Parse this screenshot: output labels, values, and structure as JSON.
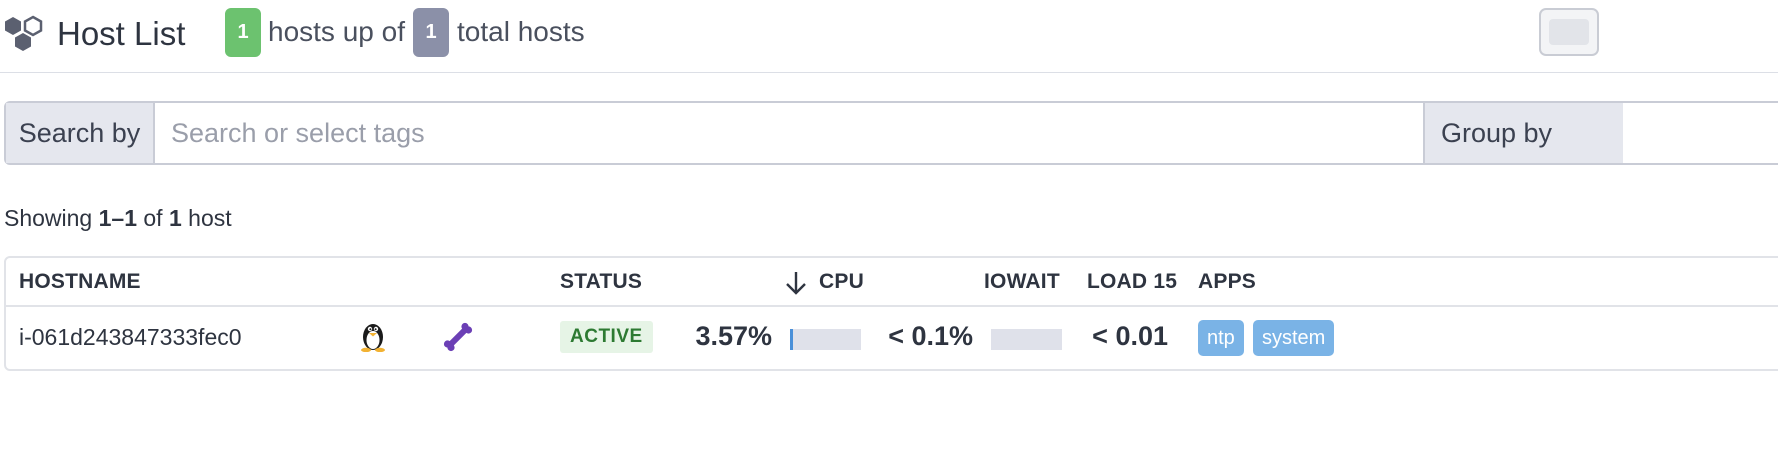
{
  "header": {
    "title": "Host List",
    "hosts_up_count": "1",
    "hosts_up_text": "hosts up of",
    "total_count": "1",
    "total_text": "total hosts"
  },
  "search": {
    "search_by_label": "Search by",
    "placeholder": "Search or select tags",
    "value": "",
    "group_by_label": "Group by"
  },
  "showing": {
    "prefix": "Showing",
    "range": "1–1",
    "of": "of",
    "count": "1",
    "suffix": "host"
  },
  "table": {
    "columns": {
      "hostname": "HOSTNAME",
      "status": "STATUS",
      "cpu": "CPU",
      "iowait": "IOWAIT",
      "load15": "LOAD 15",
      "apps": "APPS"
    },
    "rows": [
      {
        "hostname": "i-061d243847333fec0",
        "os_icon": "linux-penguin-icon",
        "agent_icon": "bone-icon",
        "status": "ACTIVE",
        "cpu": "3.57%",
        "cpu_fraction": 0.0357,
        "iowait": "< 0.1%",
        "iowait_fraction": 0.0,
        "load15": "< 0.01",
        "apps": [
          "ntp",
          "system"
        ]
      }
    ]
  },
  "colors": {
    "up_badge": "#6cc26f",
    "total_badge": "#8b90a8",
    "status_active": "#2d7a32",
    "app_tag": "#7ab3e6",
    "bar_fill": "#4a90d9",
    "agent_icon": "#6b3fb5"
  }
}
